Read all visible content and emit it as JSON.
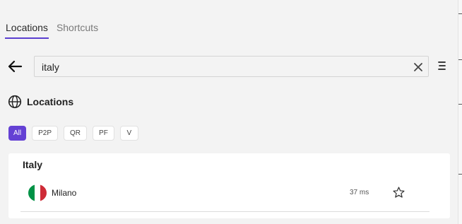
{
  "tabs": [
    {
      "label": "Locations",
      "active": true
    },
    {
      "label": "Shortcuts",
      "active": false
    }
  ],
  "search": {
    "value": "italy",
    "placeholder": ""
  },
  "section": {
    "title": "Locations",
    "icon": "globe-icon"
  },
  "filters": [
    {
      "label": "All",
      "active": true
    },
    {
      "label": "P2P",
      "active": false
    },
    {
      "label": "QR",
      "active": false
    },
    {
      "label": "PF",
      "active": false
    },
    {
      "label": "V",
      "active": false
    }
  ],
  "results": {
    "groups": [
      {
        "country": "Italy",
        "items": [
          {
            "city": "Milano",
            "latency": "37 ms",
            "flag_colors": [
              "#009246",
              "#ffffff",
              "#ce2b37"
            ]
          }
        ]
      }
    ]
  },
  "colors": {
    "accent": "#6441d4",
    "background": "#f3f3f3",
    "card": "#ffffff"
  }
}
